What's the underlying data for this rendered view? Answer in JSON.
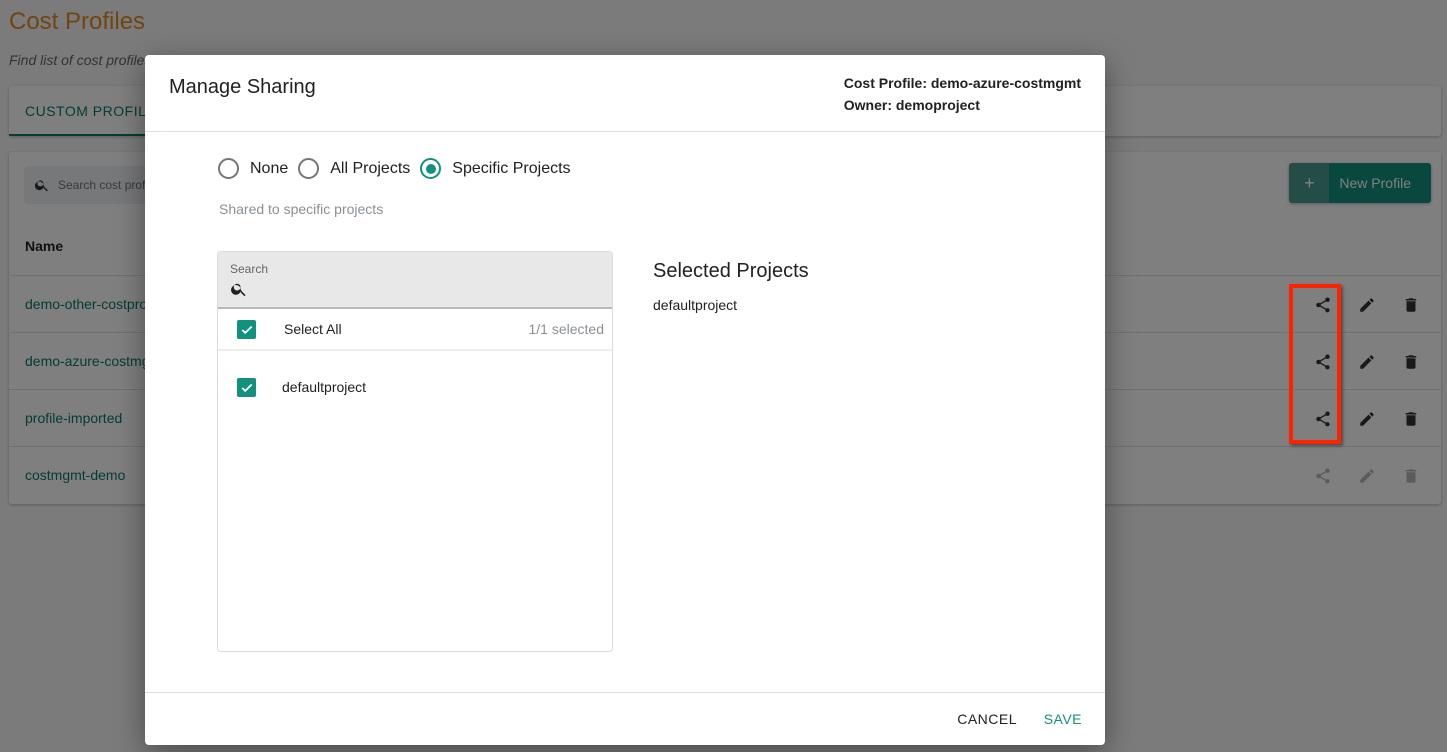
{
  "page": {
    "title": "Cost Profiles",
    "subtitle": "Find list of cost profiles here",
    "tabs": [
      {
        "label": "CUSTOM PROFILES",
        "active": true
      }
    ],
    "search": {
      "placeholder": "Search cost profiles"
    },
    "new_profile_button": {
      "icon": "plus-icon",
      "label": "New Profile"
    },
    "table": {
      "columns": [
        "Name"
      ],
      "rows": [
        {
          "name": "demo-other-costprofile",
          "actions": [
            "share-icon",
            "edit-icon",
            "delete-icon"
          ],
          "enabled": true
        },
        {
          "name": "demo-azure-costmgmt",
          "actions": [
            "share-icon",
            "edit-icon",
            "delete-icon"
          ],
          "enabled": true
        },
        {
          "name": "profile-imported",
          "actions": [
            "share-icon",
            "edit-icon",
            "delete-icon"
          ],
          "enabled": true
        },
        {
          "name": "costmgmt-demo",
          "actions": [
            "share-icon",
            "edit-icon",
            "delete-icon"
          ],
          "enabled": false
        }
      ]
    },
    "colors": {
      "accent": "#0b7a69",
      "title": "#e08a1e",
      "highlight": "#ff2200"
    }
  },
  "modal": {
    "title": "Manage Sharing",
    "cost_profile_label": "Cost Profile: demo-azure-costmgmt",
    "owner_label": "Owner: demoproject",
    "sharing_options": [
      {
        "label": "None",
        "checked": false
      },
      {
        "label": "All Projects",
        "checked": false
      },
      {
        "label": "Specific Projects",
        "checked": true
      }
    ],
    "helper_text": "Shared to specific projects",
    "project_list": {
      "search_label": "Search",
      "search_value": "",
      "select_all_label": "Select All",
      "selected_count": "1/1 selected",
      "items": [
        {
          "label": "defaultproject",
          "checked": true
        }
      ]
    },
    "selected_projects": {
      "title": "Selected Projects",
      "items": [
        "defaultproject"
      ]
    },
    "cancel_label": "CANCEL",
    "save_label": "SAVE",
    "colors": {
      "primary": "#13917f"
    }
  }
}
